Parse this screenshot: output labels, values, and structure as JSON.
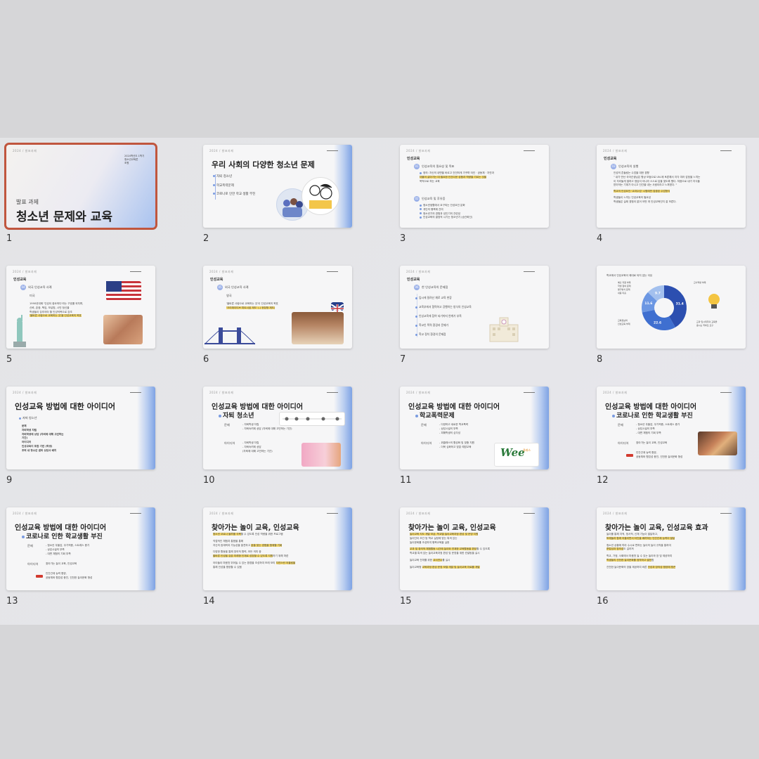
{
  "slides": [
    {
      "num": "1",
      "kicker": "발표 과제",
      "title": "청소년 문제와 교육",
      "hdr": "2024 / 발표과제",
      "meta1": "2024학년도 1학기",
      "meta2": "청소년교육론",
      "meta3": "조원",
      "selected": true
    },
    {
      "num": "2",
      "title": "우리 사회의 다양한 청소년 문제",
      "items": [
        "자퇴 청소년",
        "학교폭력문제",
        "코로나로 인한 학교 생활 부진"
      ]
    },
    {
      "num": "3",
      "heading": "인성교육",
      "sub1": "인성교육의 필요성 및 목표",
      "sub2": "인성교육 및 후유증"
    },
    {
      "num": "4",
      "heading": "인성교육",
      "sub1": "인성교육의 실행"
    },
    {
      "num": "5",
      "heading": "인성교육",
      "sub1": "외국 인성교육 사례",
      "country": "미국"
    },
    {
      "num": "6",
      "heading": "인성교육",
      "sub1": "외국 인성교육 사례",
      "country": "영국"
    },
    {
      "num": "7",
      "heading": "인성교육",
      "sub1": "한 인성교육의 문제점",
      "items": [
        "입시에 밀려난 채로 교육 현장",
        "교육부에서 협력하고 강행하는 방식의 인성교육",
        "인성교육에 참여 되기까지 연계가 부족",
        "학교인 폭력 환경과 문제가",
        "학교 정치 환경의 문제점"
      ]
    },
    {
      "num": "8",
      "chart": {
        "type": "pie",
        "values": [
          31.4,
          22.6,
          11.6,
          9.7
        ]
      }
    },
    {
      "num": "9",
      "title": "인성교육 방법에 대한 아이디어"
    },
    {
      "num": "10",
      "title": "인성교육 방법에 대한 아이디어",
      "sub": "자퇴 청소년",
      "r1": "문제",
      "r2": "아이디어"
    },
    {
      "num": "11",
      "title": "인성교육 방법에 대한 아이디어",
      "sub": "학교폭력문제",
      "r1": "문제",
      "r2": "아이디어",
      "logo": "Wee"
    },
    {
      "num": "12",
      "title": "인성교육 방법에 대한 아이디어",
      "sub": "코로나로 인한 학교생활 부진",
      "r1": "문제",
      "r2": "아이디어"
    },
    {
      "num": "13",
      "title": "인성교육 방법에 대한 아이디어",
      "sub": "코로나로 인한 학교생활 부진",
      "r1": "문제",
      "r2": "아이디어"
    },
    {
      "num": "14",
      "title": "찾아가는 놀이 교육, 인성교육"
    },
    {
      "num": "15",
      "title": "찾아가는 놀이 교육, 인성교육"
    },
    {
      "num": "16",
      "title": "찾아가는 놀이 교육, 인성교육 효과"
    }
  ],
  "colors": {
    "accent": "#7ea3e4",
    "selected": "#c0563e",
    "highlight": "#f4d86a"
  }
}
